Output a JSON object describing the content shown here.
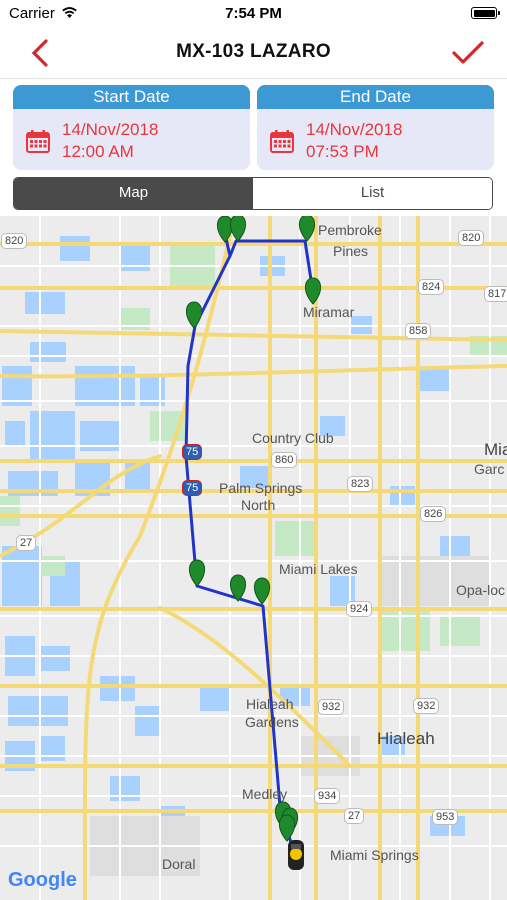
{
  "status": {
    "carrier": "Carrier",
    "time": "7:54 PM"
  },
  "nav": {
    "title": "MX-103 LAZARO"
  },
  "start": {
    "header": "Start Date",
    "date": "14/Nov/2018",
    "time": "12:00 AM"
  },
  "end": {
    "header": "End Date",
    "date": "14/Nov/2018",
    "time": "07:53 PM"
  },
  "tabs": {
    "map": "Map",
    "list": "List"
  },
  "map": {
    "places": {
      "pembroke1": "Pembroke",
      "pembroke2": "Pines",
      "miramar": "Miramar",
      "country_club": "Country Club",
      "palm1": "Palm Springs",
      "palm2": "North",
      "miami_lakes": "Miami Lakes",
      "opa": "Opa-loc",
      "hialeah_g1": "Hialeah",
      "hialeah_g2": "Gardens",
      "hialeah": "Hialeah",
      "medley": "Medley",
      "doral": "Doral",
      "miami_springs": "Miami Springs",
      "miami": "Mia",
      "garden": "Garc"
    },
    "shields": {
      "r820a": "820",
      "r820b": "820",
      "r817": "817",
      "r824": "824",
      "r858": "858",
      "r860": "860",
      "r823": "823",
      "r826": "826",
      "r27a": "27",
      "r924": "924",
      "r932a": "932",
      "r932b": "932",
      "r934": "934",
      "r27b": "27",
      "r953": "953",
      "i75a": "75",
      "i75b": "75"
    },
    "attribution": "Google",
    "colors": {
      "route": "#2134c9",
      "marker": "#1f8a2c",
      "water": "#a9d1ff",
      "road": "#f6d977",
      "park": "#c5e8c5"
    }
  }
}
